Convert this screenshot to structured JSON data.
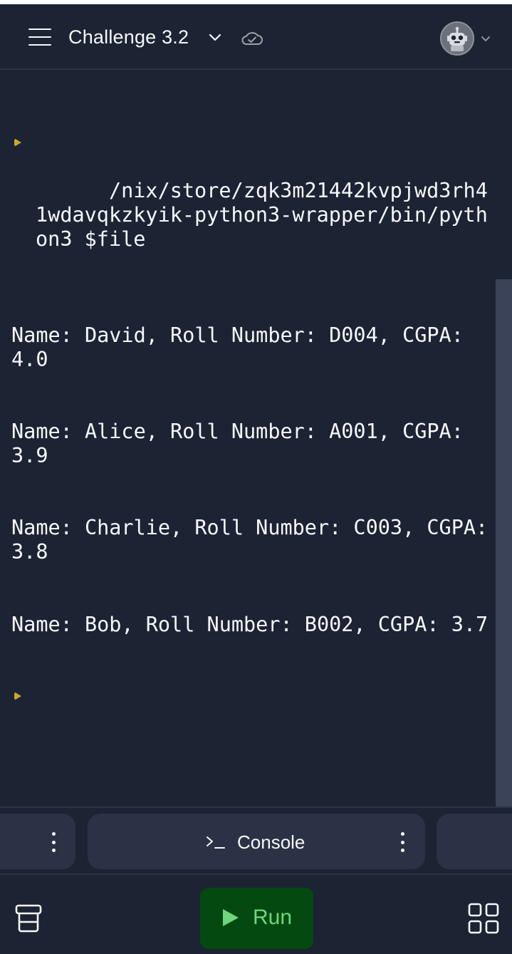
{
  "header": {
    "title": "Challenge 3.2",
    "icons": {
      "menu": "hamburger-icon",
      "dropdown": "chevron-down-icon",
      "sync": "cloud-check-icon",
      "avatar": "user-avatar",
      "avatar_dropdown": "chevron-down-icon"
    }
  },
  "console": {
    "command_path": "/nix/store/zqk3m21442kvpjwd3rh41wdavqkzkyik-python3-wrapper/bin/python3 $file",
    "output_lines": [
      "Name: David, Roll Number: D004, CGPA: 4.0",
      "Name: Alice, Roll Number: A001, CGPA: 3.9",
      "Name: Charlie, Roll Number: C003, CGPA: 3.8",
      "Name: Bob, Roll Number: B002, CGPA: 3.7"
    ]
  },
  "tabs": {
    "active_label": "Console",
    "active_icon": "terminal-icon"
  },
  "bottom": {
    "run_label": "Run",
    "run_icon": "play-icon",
    "left_icon": "database-icon",
    "right_icon": "grid-icon"
  },
  "colors": {
    "background": "#1c2333",
    "surface": "#2b3245",
    "text": "#f5f9fc",
    "prompt_accent": "#c8a72b",
    "run_bg": "#044a10",
    "run_text": "#6fd67d"
  }
}
